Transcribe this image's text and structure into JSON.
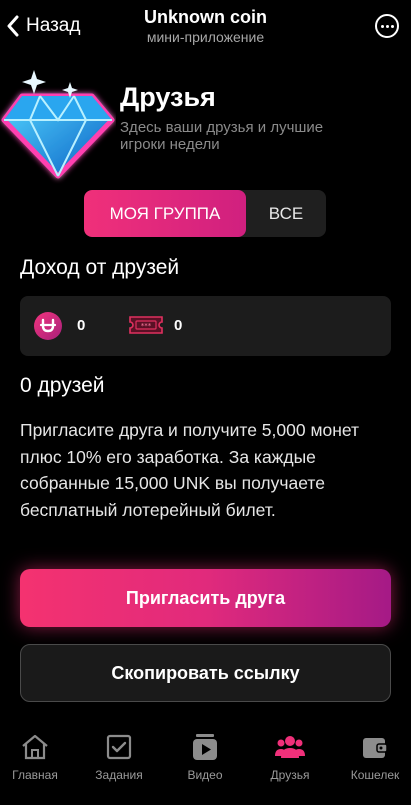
{
  "topbar": {
    "back_label": "Назад",
    "title": "Unknown coin",
    "subtitle": "мини-приложение"
  },
  "header": {
    "title": "Друзья",
    "description": "Здесь ваши друзья и лучшие игроки недели"
  },
  "tabs": [
    {
      "label": "МОЯ ГРУППА",
      "active": true
    },
    {
      "label": "ВСЕ",
      "active": false
    }
  ],
  "income": {
    "title": "Доход от друзей",
    "coins": "0",
    "tickets": "0"
  },
  "friends": {
    "count_label": "0 друзей",
    "invite_text": "Пригласите друга и получите 5,000 монет плюс 10% его заработка. За каждые собранные 15,000 UNK вы получаете бесплатный лотерейный билет."
  },
  "buttons": {
    "invite": "Пригласить друга",
    "copy_link": "Скопировать ссылку"
  },
  "nav": [
    {
      "label": "Главная",
      "icon": "home-icon",
      "active": false
    },
    {
      "label": "Задания",
      "icon": "tasks-icon",
      "active": false
    },
    {
      "label": "Видео",
      "icon": "video-icon",
      "active": false
    },
    {
      "label": "Друзья",
      "icon": "friends-icon",
      "active": true
    },
    {
      "label": "Кошелек",
      "icon": "wallet-icon",
      "active": false
    }
  ],
  "colors": {
    "accent": "#f0307a",
    "accent_end": "#a51a86",
    "background": "#000000",
    "card": "#1c1c1c"
  }
}
